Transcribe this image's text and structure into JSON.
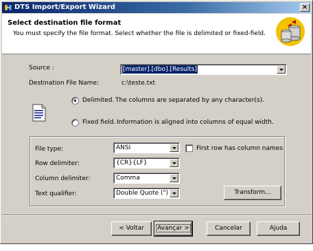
{
  "window": {
    "title": "DTS Import/Export Wizard",
    "close_label": "×"
  },
  "header": {
    "title": "Select destination file format",
    "subtitle": "You must specify the file format. Select whether the file is delimited or fixed-field."
  },
  "source": {
    "label": "Source :",
    "value": "[master].[dbo].[Results]"
  },
  "destination": {
    "label": "Destination File Name:",
    "value": "c:\\teste.txt"
  },
  "format": {
    "delimited": {
      "label": "Delimited.",
      "description": "The columns are separated by any character(s).",
      "checked": true
    },
    "fixed": {
      "label": "Fixed field.",
      "description": "Information is aligned into columns of equal width.",
      "checked": false
    }
  },
  "options": {
    "file_type": {
      "label": "File type:",
      "value": "ANSI"
    },
    "first_row": {
      "label": "First row has column names",
      "checked": false
    },
    "row_delimiter": {
      "label": "Row delimiter:",
      "value": "{CR}{LF}"
    },
    "column_delimiter": {
      "label": "Column delimiter:",
      "value": "Comma"
    },
    "text_qualifier": {
      "label": "Text qualifier:",
      "value": "Double Quote (\")"
    },
    "transform_label": "Transform..."
  },
  "buttons": {
    "back": "< Voltar",
    "next": "Avançar >",
    "cancel": "Cancelar",
    "help": "Ajuda"
  },
  "icons": {
    "app": "dts-wizard-icon",
    "header": "database-transfer-icon",
    "format": "text-document-icon"
  },
  "colors": {
    "titlebar_start": "#0a246a",
    "titlebar_end": "#a6caf0",
    "selection": "#0a246a",
    "face": "#d4d0c8"
  }
}
